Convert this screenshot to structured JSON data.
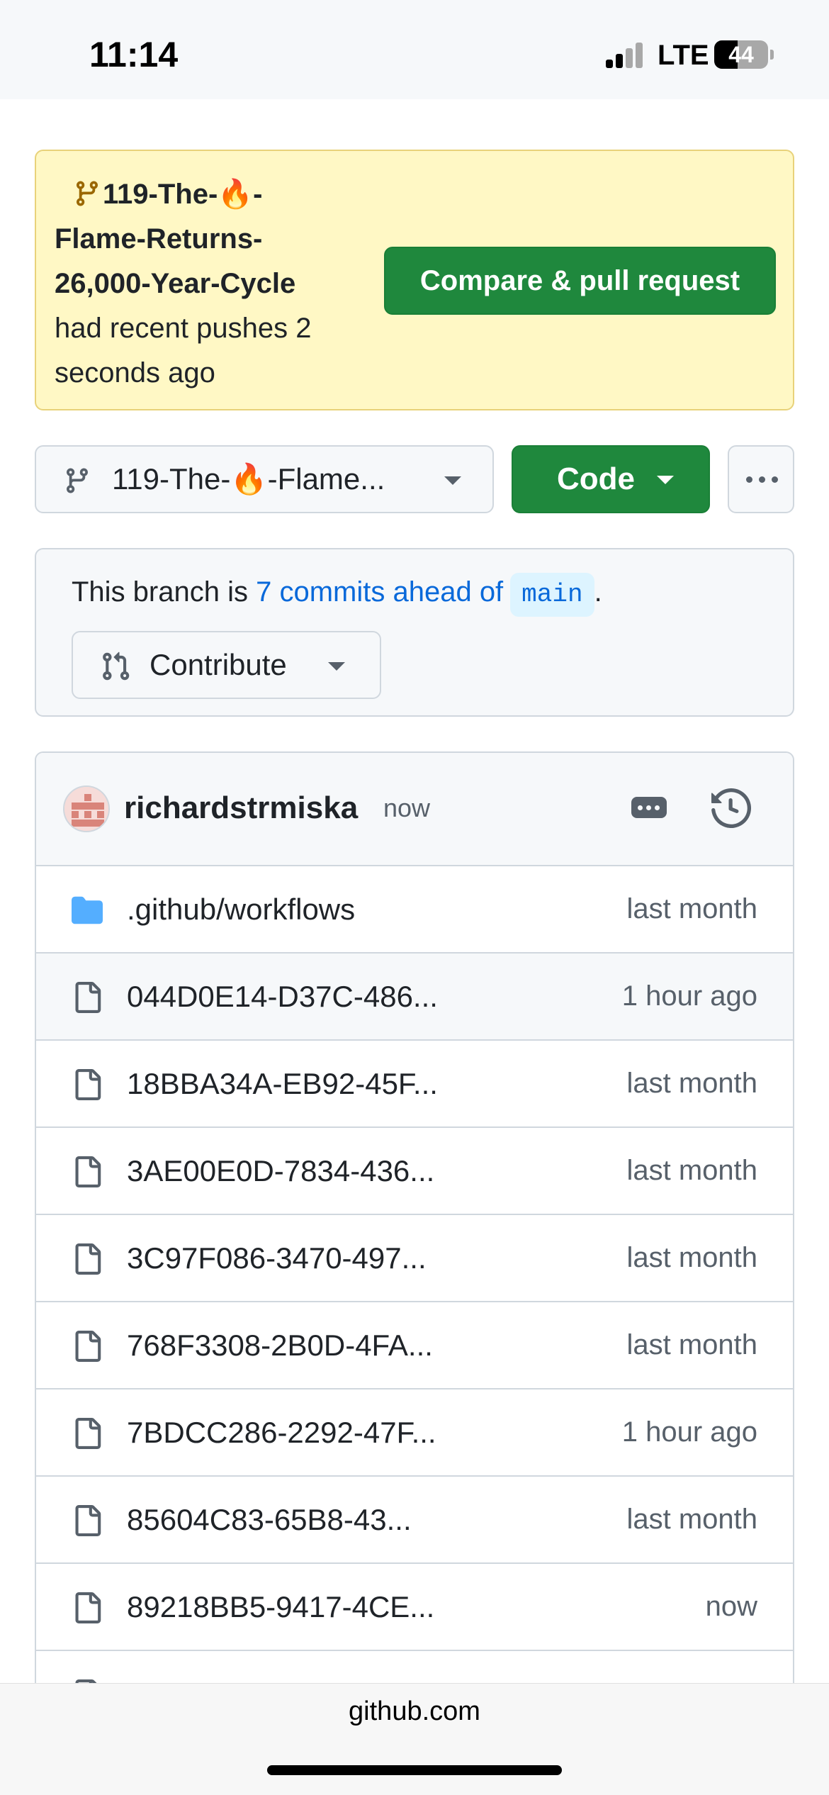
{
  "status_bar": {
    "time": "11:14",
    "network": "LTE",
    "battery": "44",
    "battery_level": 0.44
  },
  "push_banner": {
    "branch_name_lines": [
      "119-The-🔥-",
      "Flame-Returns-",
      "26,000-Year-Cycle"
    ],
    "message_lines": [
      "had recent pushes 2",
      "seconds ago"
    ],
    "compare_button": "Compare & pull request",
    "icon": "git-branch-icon"
  },
  "branch_selector": {
    "label": "119-The-🔥-Flame...",
    "icon": "git-branch-icon"
  },
  "code_button": "Code",
  "more_button_icon": "kebab-horizontal-icon",
  "ahead_notice": {
    "prefix": "This branch is ",
    "link": "7 commits ahead of",
    "base_branch": "main",
    "suffix": ".",
    "contribute_button": "Contribute",
    "contribute_icon": "git-pull-request-icon"
  },
  "latest_commit": {
    "author": "richardstrmiska",
    "time": "now",
    "ellipsis_icon": "ellipsis-icon",
    "history_icon": "history-icon"
  },
  "files": [
    {
      "type": "folder",
      "name": ".github/workflows",
      "time": "last month"
    },
    {
      "type": "file",
      "name": "044D0E14-D37C-486...",
      "time": "1 hour ago"
    },
    {
      "type": "file",
      "name": "18BBA34A-EB92-45F...",
      "time": "last month"
    },
    {
      "type": "file",
      "name": "3AE00E0D-7834-436...",
      "time": "last month"
    },
    {
      "type": "file",
      "name": "3C97F086-3470-497...",
      "time": "last month"
    },
    {
      "type": "file",
      "name": "768F3308-2B0D-4FA...",
      "time": "last month"
    },
    {
      "type": "file",
      "name": "7BDCC286-2292-47F...",
      "time": "1 hour ago"
    },
    {
      "type": "file",
      "name": "85604C83-65B8-43...",
      "time": "last month"
    },
    {
      "type": "file",
      "name": "89218BB5-9417-4CE...",
      "time": "now"
    }
  ],
  "browser": {
    "url": "github.com"
  },
  "colors": {
    "primary_green": "#1f883d",
    "link_blue": "#0969da",
    "banner_yellow": "#fff8c5",
    "folder_blue": "#54aeff"
  }
}
